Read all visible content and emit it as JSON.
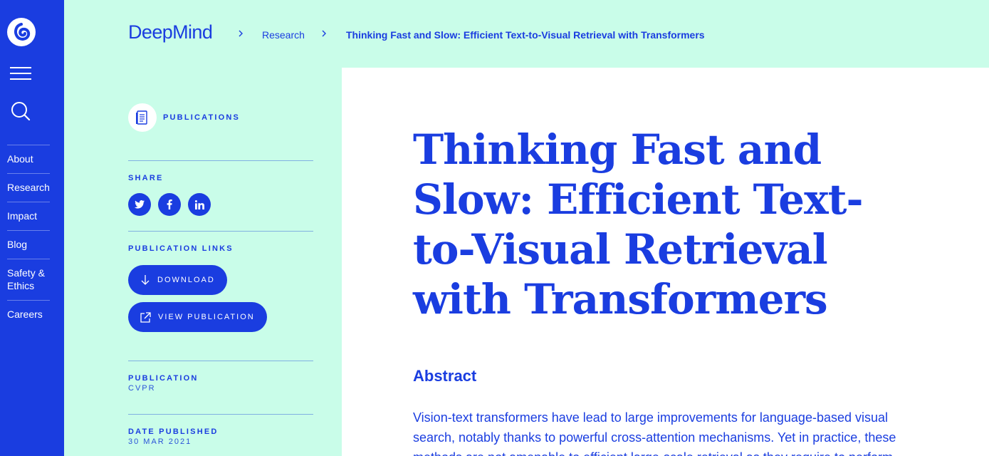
{
  "brand": "DeepMind",
  "breadcrumb": {
    "research": "Research",
    "current": "Thinking Fast and Slow: Efficient Text-to-Visual Retrieval with Transformers"
  },
  "rail": {
    "nav": [
      "About",
      "Research",
      "Impact",
      "Blog",
      "Safety & Ethics",
      "Careers"
    ]
  },
  "sidebar": {
    "publications_label": "PUBLICATIONS",
    "share_label": "SHARE",
    "links_label": "PUBLICATION LINKS",
    "download_label": "DOWNLOAD",
    "view_label": "VIEW PUBLICATION",
    "publication_label": "PUBLICATION",
    "publication_value": "CVPR",
    "date_label": "DATE PUBLISHED",
    "date_value": "30 MAR 2021"
  },
  "main": {
    "title": "Thinking Fast and Slow: Efficient Text-to-Visual Retrieval with Transformers",
    "abstract_heading": "Abstract",
    "abstract_text": "Vision-text transformers have lead to large improvements for language-based visual search, notably thanks to powerful cross-attention mechanisms. Yet in practice, these methods are not amenable to efficient large-scale retrieval as they require to perform"
  },
  "icons": {
    "logo": "deepmind-logo-icon",
    "menu": "hamburger-menu-icon",
    "search": "search-icon",
    "twitter": "twitter-icon",
    "facebook": "facebook-icon",
    "linkedin": "linkedin-icon",
    "download": "download-arrow-icon",
    "external": "external-link-icon",
    "publication": "document-icon"
  },
  "colors": {
    "accent": "#1a3de0",
    "background": "#c9fde9",
    "content": "#ffffff"
  }
}
